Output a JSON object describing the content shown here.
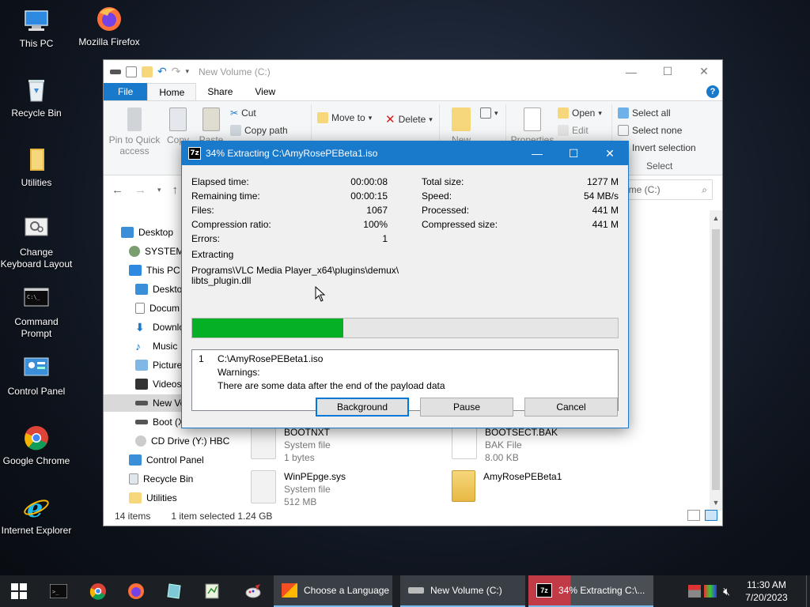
{
  "desktop": {
    "icons": [
      {
        "label": "This PC"
      },
      {
        "label": "Mozilla Firefox"
      },
      {
        "label": "Recycle Bin"
      },
      {
        "label": "Utilities"
      },
      {
        "label": "Change Keyboard Layout"
      },
      {
        "label": "Command Prompt"
      },
      {
        "label": "Control Panel"
      },
      {
        "label": "Google Chrome"
      },
      {
        "label": "Internet Explorer"
      }
    ]
  },
  "explorer": {
    "title": "New Volume (C:)",
    "tabs": {
      "file": "File",
      "home": "Home",
      "share": "Share",
      "view": "View"
    },
    "ribbon": {
      "pin": "Pin to Quick access",
      "copy": "Copy",
      "paste": "Paste",
      "cut": "Cut",
      "copy_path": "Copy path",
      "move_to": "Move to",
      "delete": "Delete",
      "new": "New",
      "properties": "Properties",
      "open": "Open",
      "edit": "Edit",
      "select_all": "Select all",
      "select_none": "Select none",
      "invert_selection": "Invert selection",
      "select_group": "Select"
    },
    "search_placeholder": "ume (C:)",
    "nav": [
      {
        "label": "Desktop"
      },
      {
        "label": "SYSTEM"
      },
      {
        "label": "This PC"
      },
      {
        "label": "Desktop"
      },
      {
        "label": "Docum"
      },
      {
        "label": "Downlo"
      },
      {
        "label": "Music"
      },
      {
        "label": "Picture"
      },
      {
        "label": "Videos"
      },
      {
        "label": "New Vo"
      },
      {
        "label": "Boot (X"
      },
      {
        "label": "CD Drive (Y:) HBC"
      },
      {
        "label": "Control Panel"
      },
      {
        "label": "Recycle Bin"
      },
      {
        "label": "Utilities"
      }
    ],
    "files": [
      {
        "name": "BOOTNXT",
        "type": "System file",
        "size": "1 bytes"
      },
      {
        "name": "BOOTSECT.BAK",
        "type": "BAK File",
        "size": "8.00 KB"
      },
      {
        "name": "WinPEpge.sys",
        "type": "System file",
        "size": "512 MB"
      },
      {
        "name": "AmyRosePEBeta1",
        "type": "",
        "size": ""
      }
    ],
    "status": {
      "count": "14 items",
      "selected": "1 item selected  1.24 GB"
    }
  },
  "dialog": {
    "title": "34% Extracting C:\\AmyRosePEBeta1.iso",
    "progress": 0.355,
    "stats_left": [
      {
        "label": "Elapsed time:",
        "value": "00:00:08"
      },
      {
        "label": "Remaining time:",
        "value": "00:00:15"
      },
      {
        "label": "Files:",
        "value": "1067"
      },
      {
        "label": "Compression ratio:",
        "value": "100%"
      },
      {
        "label": "Errors:",
        "value": "1"
      }
    ],
    "stats_right": [
      {
        "label": "Total size:",
        "value": "1277 M"
      },
      {
        "label": "Speed:",
        "value": "54 MB/s"
      },
      {
        "label": "Processed:",
        "value": "441 M"
      },
      {
        "label": "Compressed size:",
        "value": "441 M"
      }
    ],
    "operation": "Extracting",
    "current_path_1": "Programs\\VLC Media Player_x64\\plugins\\demux\\",
    "current_path_2": "libts_plugin.dll",
    "log": {
      "index": "1",
      "file": "C:\\AmyRosePEBeta1.iso",
      "warn_label": "Warnings:",
      "warn_text": "There are some data after the end of the payload data"
    },
    "buttons": {
      "background": "Background",
      "pause": "Pause",
      "cancel": "Cancel"
    }
  },
  "taskbar": {
    "apps": [
      {
        "label": "Choose a Language"
      },
      {
        "label": "New Volume (C:)"
      },
      {
        "label": "34% Extracting C:\\..."
      }
    ],
    "time": "11:30 AM",
    "date": "7/20/2023"
  },
  "colors": {
    "accent": "#1979ca",
    "progress": "#06b025",
    "taskbar": "#1c1f23"
  }
}
